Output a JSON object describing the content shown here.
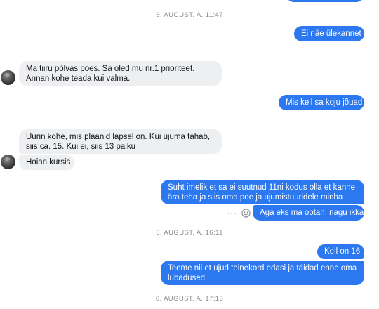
{
  "timestamps": {
    "t1": "6. AUGUST. A. 11:47",
    "t2": "6. AUGUST. A. 16:11",
    "t3": "6. AUGUST. A. 17:13"
  },
  "messages": {
    "m1": "Ei näe ülekannet",
    "m2": "Ma tiiru põlvas poes. Sa oled mu nr.1 prioriteet. Annan kohe teada kui valma.",
    "m3": "Mis kell sa koju jõuad",
    "m4": "Uurin kohe, mis plaanid lapsel on. Kui ujuma tahab, siis ca. 15. Kui ei, siis 13 paiku",
    "m5": "Hoian kursis",
    "m6": "Suht imelik et sa ei suutnud 11ni kodus olla et kanne ära teha ja siis oma poe ja ujumistuuridele minba",
    "m7": "Aga eks ma ootan, nagu ikka",
    "m8": "Kell on 16",
    "m9": "Teeme nii et ujud teinekord edasi ja täidad enne oma lubadused."
  },
  "actions": {
    "more_glyph": "···"
  },
  "colors": {
    "outgoing_bubble": "#2b78f0",
    "incoming_bubble": "#eeeff1",
    "timestamp": "#8a8d91"
  },
  "icons": [
    "more-icon",
    "emoji-icon"
  ]
}
